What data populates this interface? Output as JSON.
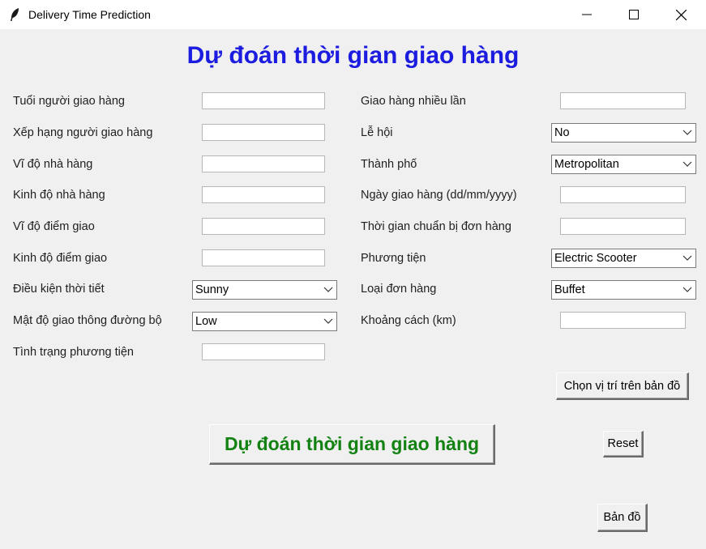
{
  "window": {
    "title": "Delivery Time Prediction",
    "controls": [
      "minimize-icon",
      "maximize-icon",
      "close-icon"
    ],
    "app_icon": "feather-icon"
  },
  "heading": "Dự đoán thời gian giao hàng",
  "colors": {
    "heading": "#1c1ce0",
    "predict_text": "#138213",
    "background": "#f0f0f0"
  },
  "left_form": {
    "age_label": "Tuổi người giao hàng",
    "age_value": "",
    "rating_label": "Xếp hạng người giao hàng",
    "rating_value": "",
    "rest_lat_label": "Vĩ độ nhà hàng",
    "rest_lat_value": "",
    "rest_lon_label": "Kinh độ nhà hàng",
    "rest_lon_value": "",
    "drop_lat_label": "Vĩ độ điểm giao",
    "drop_lat_value": "",
    "drop_lon_label": "Kinh độ điểm giao",
    "drop_lon_value": "",
    "weather_label": "Điều kiện thời tiết",
    "weather_value": "Sunny",
    "traffic_label": "Mật độ giao thông đường bộ",
    "traffic_value": "Low",
    "vehicle_cond_label": "Tình trạng phương tiện",
    "vehicle_cond_value": ""
  },
  "right_form": {
    "multi_label": "Giao hàng nhiều lần",
    "multi_value": "",
    "festival_label": "Lễ hội",
    "festival_value": "No",
    "city_label": "Thành phố",
    "city_value": "Metropolitan",
    "date_label": "Ngày giao hàng (dd/mm/yyyy)",
    "date_value": "",
    "prep_label": "Thời gian chuẩn bị đơn hàng",
    "prep_value": "",
    "vehicle_label": "Phương tiện",
    "vehicle_value": "Electric Scooter",
    "order_label": "Loại đơn hàng",
    "order_value": "Buffet",
    "distance_label": "Khoảng cách (km)",
    "distance_value": ""
  },
  "buttons": {
    "map_pick": "Chọn vị trí trên bản đồ",
    "predict": "Dự đoán thời gian giao hàng",
    "reset": "Reset",
    "map": "Bản đồ"
  }
}
